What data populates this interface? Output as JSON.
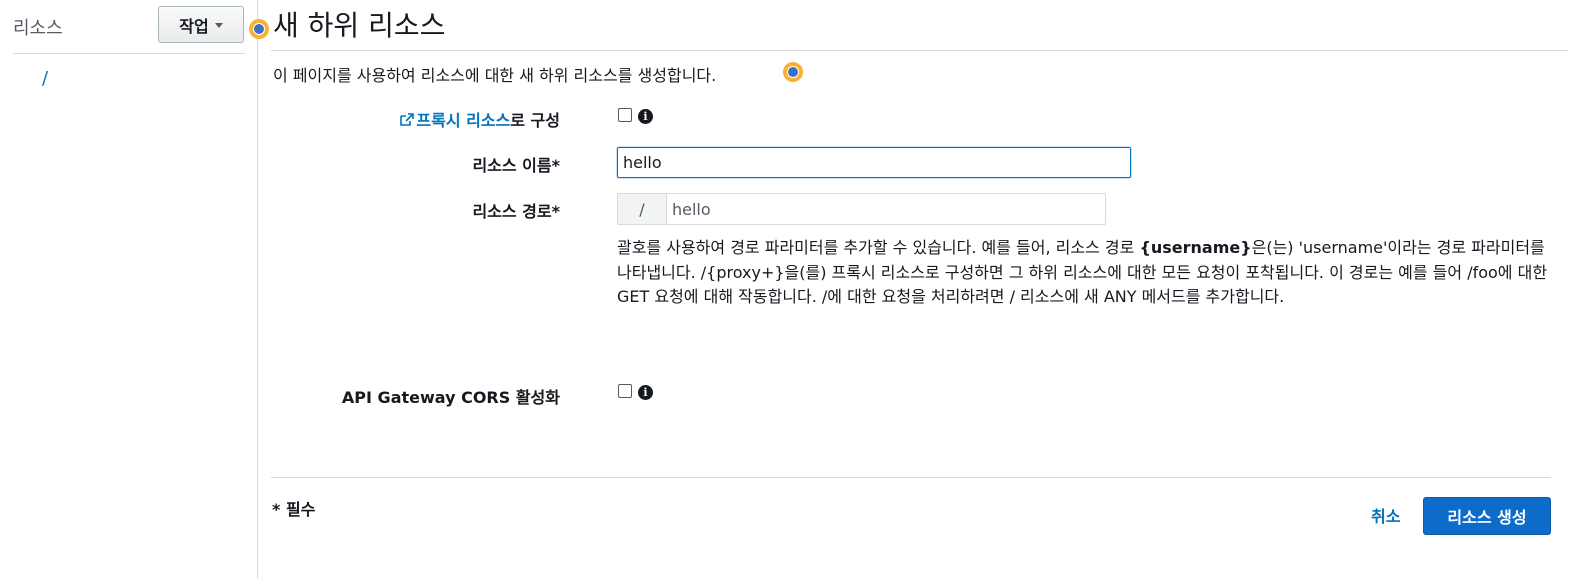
{
  "sidebar": {
    "title": "리소스",
    "actions_label": "작업",
    "tree_root": "/"
  },
  "main": {
    "title": "새 하위 리소스",
    "description": "이 페이지를 사용하여 리소스에 대한 새 하위 리소스를 생성합니다.",
    "proxy": {
      "link_label": "프록시 리소스",
      "label_suffix": "로 구성"
    },
    "resource_name": {
      "label": "리소스 이름*",
      "value": "hello"
    },
    "resource_path": {
      "label": "리소스 경로*",
      "prefix": "/",
      "value": "hello"
    },
    "help": {
      "part1": "괄호를 사용하여 경로 파라미터를 추가할 수 있습니다. 예를 들어, 리소스 경로 ",
      "bold": "{username}",
      "part2": "은(는) 'username'이라는 경로 파라미터를 나타냅니다. /{proxy+}을(를) 프록시 리소스로 구성하면 그 하위 리소스에 대한 모든 요청이 포착됩니다. 이 경로는 예를 들어 /foo에 대한 GET 요청에 대해 작동합니다. /에 대한 요청을 처리하려면 / 리소스에 새 ANY 메서드를 추가합니다."
    },
    "cors": {
      "label": "API Gateway CORS 활성화"
    },
    "info_glyph": "i"
  },
  "footer": {
    "required_note": "* 필수",
    "cancel_label": "취소",
    "create_label": "리소스 생성"
  },
  "colors": {
    "primary": "#0d6bc9",
    "link": "#0073bb",
    "marker_outer": "#f7b233",
    "marker_inner": "#3b6fc4"
  }
}
